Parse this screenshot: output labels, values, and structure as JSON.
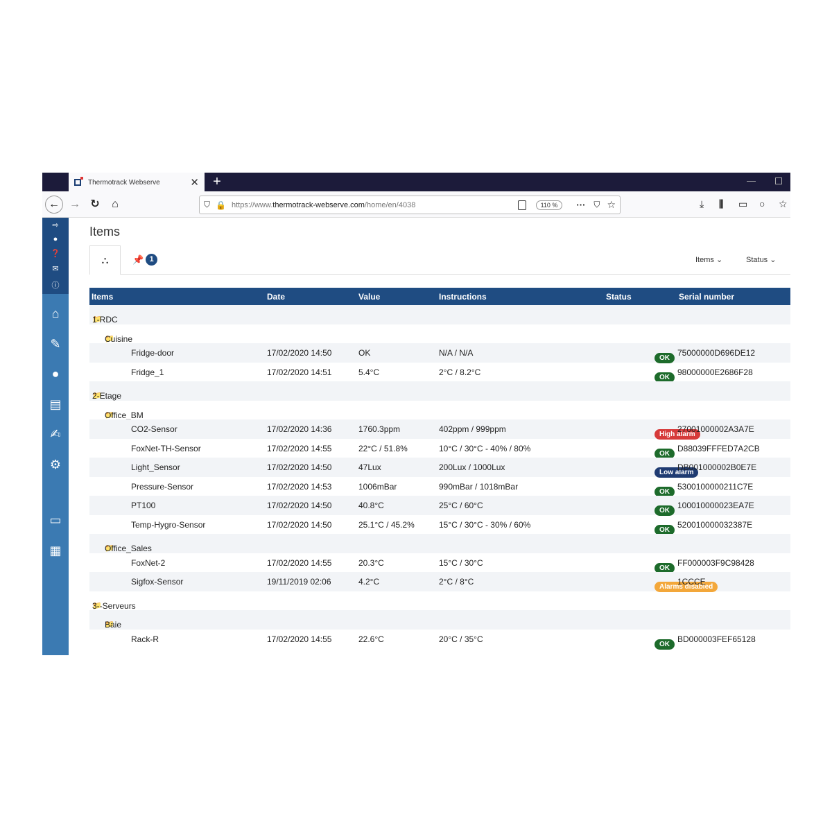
{
  "browser": {
    "tab_title": "Thermotrack Webserve",
    "url_prefix": "https://www.",
    "url_domain": "thermotrack-webserve.com",
    "url_path": "/home/en/4038",
    "zoom": "110 %"
  },
  "page": {
    "title": "Items",
    "pin_badge": "1",
    "dropdown_items": "Items",
    "dropdown_status": "Status"
  },
  "table": {
    "headers": [
      "Items",
      "Date",
      "Value",
      "Instructions",
      "Status",
      "Serial number"
    ],
    "rows": [
      {
        "kind": "group",
        "level": 0,
        "name": "1-RDC"
      },
      {
        "kind": "group",
        "level": 1,
        "name": "Cuisine"
      },
      {
        "kind": "item",
        "name": "Fridge-door",
        "date": "17/02/2020 14:50",
        "value": "OK",
        "instructions": "N/A / N/A",
        "status": "OK",
        "status_type": "ok",
        "serial": "75000000D696DE12"
      },
      {
        "kind": "item",
        "name": "Fridge_1",
        "date": "17/02/2020 14:51",
        "value": "5.4°C",
        "instructions": "2°C / 8.2°C",
        "status": "OK",
        "status_type": "ok",
        "serial": "98000000E2686F28"
      },
      {
        "kind": "group",
        "level": 0,
        "name": "2-Etage"
      },
      {
        "kind": "group",
        "level": 1,
        "name": "Office_BM"
      },
      {
        "kind": "item",
        "name": "CO2-Sensor",
        "date": "17/02/2020 14:36",
        "value": "1760.3ppm",
        "instructions": "402ppm / 999ppm",
        "status": "High alarm",
        "status_type": "high",
        "serial": "27001000002A3A7E"
      },
      {
        "kind": "item",
        "name": "FoxNet-TH-Sensor",
        "date": "17/02/2020 14:55",
        "value": "22°C / 51.8%",
        "instructions": "10°C / 30°C - 40% / 80%",
        "status": "OK",
        "status_type": "ok",
        "serial": "D88039FFFED7A2CB"
      },
      {
        "kind": "item",
        "name": "Light_Sensor",
        "date": "17/02/2020 14:50",
        "value": "47Lux",
        "instructions": "200Lux / 1000Lux",
        "status": "Low alarm",
        "status_type": "low",
        "serial": "DB001000002B0E7E"
      },
      {
        "kind": "item",
        "name": "Pressure-Sensor",
        "date": "17/02/2020 14:53",
        "value": "1006mBar",
        "instructions": "990mBar / 1018mBar",
        "status": "OK",
        "status_type": "ok",
        "serial": "5300100000211C7E"
      },
      {
        "kind": "item",
        "name": "PT100",
        "date": "17/02/2020 14:50",
        "value": "40.8°C",
        "instructions": "25°C / 60°C",
        "status": "OK",
        "status_type": "ok",
        "serial": "100010000023EA7E"
      },
      {
        "kind": "item",
        "name": "Temp-Hygro-Sensor",
        "date": "17/02/2020 14:50",
        "value": "25.1°C / 45.2%",
        "instructions": "15°C / 30°C - 30% / 60%",
        "status": "OK",
        "status_type": "ok",
        "serial": "520010000032387E"
      },
      {
        "kind": "group",
        "level": 1,
        "name": "Office_Sales"
      },
      {
        "kind": "item",
        "name": "FoxNet-2",
        "date": "17/02/2020 14:55",
        "value": "20.3°C",
        "instructions": "15°C / 30°C",
        "status": "OK",
        "status_type": "ok",
        "serial": "FF000003F9C98428"
      },
      {
        "kind": "item",
        "name": "Sigfox-Sensor",
        "date": "19/11/2019 02:06",
        "value": "4.2°C",
        "instructions": "2°C / 8°C",
        "status": "Alarms disabled",
        "status_type": "dis",
        "serial": "1CCCE"
      },
      {
        "kind": "group",
        "level": 0,
        "name": "3--Serveurs"
      },
      {
        "kind": "group",
        "level": 1,
        "name": "Baie"
      },
      {
        "kind": "item",
        "name": "Rack-R",
        "date": "17/02/2020 14:55",
        "value": "22.6°C",
        "instructions": "20°C / 35°C",
        "status": "OK",
        "status_type": "ok",
        "serial": "BD000003FEF65128"
      }
    ]
  },
  "icons": {
    "sidebar_top": [
      "logout-icon",
      "user-icon",
      "help-icon",
      "chat-icon",
      "info-icon"
    ],
    "sidebar_main": [
      "home-icon",
      "pencil-icon",
      "bomb-icon",
      "hard-drive-icon",
      "edit-icon",
      "cogs-icon",
      "monitor-icon",
      "qrcode-icon"
    ]
  },
  "colors": {
    "header_bg": "#1f4c82",
    "sidebar_bg": "#3b7ab2",
    "ok": "#1d6b2b",
    "high_alarm": "#d63a3a",
    "low_alarm": "#1f3b72",
    "alarms_disabled": "#f3a73a"
  }
}
